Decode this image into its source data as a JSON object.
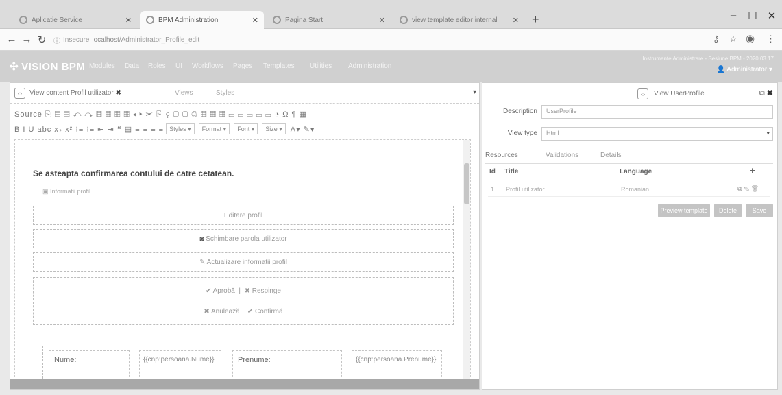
{
  "browser": {
    "tabs": [
      {
        "label": "Aplicatie Service"
      },
      {
        "label": "BPM Administration"
      },
      {
        "label": "Pagina Start"
      },
      {
        "label": "view template editor internal"
      }
    ],
    "url_scheme": "Insecure",
    "url_host": "localhost",
    "url_path": "/Administrator_Profile_edit"
  },
  "app": {
    "logo": "VISION BPM",
    "nav": [
      "Modules",
      "Data",
      "Roles",
      "UI",
      "Workflows",
      "Pages",
      "Templates",
      "Utilities",
      "Administration"
    ],
    "user_line": "Instrumente Administrare - Sesiune BPM - 2020.03.17",
    "admin_label": "Administrator"
  },
  "editor": {
    "title": "View content Profil utilizator",
    "tabs": [
      "Views",
      "Styles"
    ],
    "toolbar_row1": "Source ⎘ ▤ ▤ ↶ ↷ ▦ ▦ ▦ ▦ ◂ ▸ ✂ ⎘ ⚲ ▢ ▢ ◎ ▦ ▦ ▦ ▭ ▭ ▭ ▭ ▭ ◔ Ω ¶ ▦",
    "toolbar_row2": "B I U abc x₂ x² ⁝≡ ⁝≡ ⇤ ⇥ ❝ ▤ ≡ ≡ ≡ ≡",
    "style_select": "Styles",
    "format_select": "Format",
    "font_select": "Font",
    "size_select": "Size",
    "heading": "Se asteapta confirmarea contului de catre cetatean.",
    "subline": "Informatii profil",
    "btn_edit": "Editare profil",
    "btn_change_pwd": "Schimbare parola utilizator",
    "btn_update_info": "Actualizare informatii profil",
    "btn_ok": "✔ Aprobă",
    "btn_reject": "✖ Respinge",
    "btn_cancel": "✖ Anulează",
    "btn_confirm": "✔ Confirmă",
    "form": {
      "label_name": "Nume:",
      "ph_name": "{{cnp:persoana.Nume}}",
      "label_firstname": "Prenume:",
      "ph_firstname": "{{cnp:persoana.Prenume}}"
    }
  },
  "right": {
    "title": "View UserProfile",
    "desc_label": "Description",
    "desc_value": "UserProfile",
    "viewtype_label": "View type",
    "viewtype_value": "Html",
    "tabs": [
      "Resources",
      "Validations",
      "Details"
    ],
    "table_headers": {
      "id": "Id",
      "title": "Title",
      "language": "Language",
      "add": "+"
    },
    "row": {
      "id": "1",
      "title": "Profil utilizator",
      "language": "Romanian"
    },
    "buttons": {
      "preview": "Preview template",
      "delete": "Delete",
      "save": "Save"
    }
  }
}
